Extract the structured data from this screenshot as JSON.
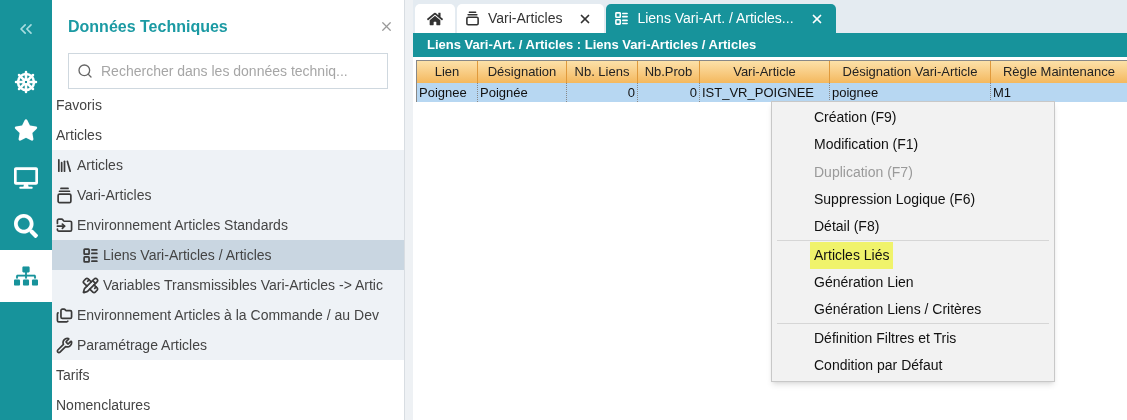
{
  "rail": {
    "items": [
      {
        "kind": "wheel",
        "selected": false
      },
      {
        "kind": "star",
        "selected": false
      },
      {
        "kind": "monitor",
        "selected": false
      },
      {
        "kind": "search",
        "selected": false
      },
      {
        "kind": "sitemap",
        "selected": true
      }
    ]
  },
  "panel": {
    "title": "Données Techniques",
    "search": {
      "placeholder": "Rechercher dans les données techniq..."
    },
    "tree": [
      {
        "label": "Favoris",
        "selected": false
      },
      {
        "label": "Articles",
        "selected": false,
        "children": [
          {
            "label": "Articles",
            "kind": "books",
            "selected": false
          },
          {
            "label": "Vari-Articles",
            "kind": "cards",
            "selected": false
          },
          {
            "label": "Environnement Articles Standards",
            "kind": "folder",
            "selected": false,
            "children": [
              {
                "label": "Liens Vari-Articles / Articles",
                "kind": "grid",
                "selected": true
              },
              {
                "label": "Variables Transmissibles Vari-Articles -> Artic",
                "kind": "tools",
                "selected": false
              }
            ]
          },
          {
            "label": "Environnement Articles à la Commande / au Dev",
            "kind": "folders",
            "selected": false
          },
          {
            "label": "Paramétrage Articles",
            "kind": "wrench",
            "selected": false
          }
        ]
      },
      {
        "label": "Tarifs",
        "selected": false
      },
      {
        "label": "Nomenclatures",
        "selected": false
      }
    ]
  },
  "tabs": [
    {
      "kind": "home",
      "selected": false
    },
    {
      "kind": "page",
      "label": "Vari-Articles",
      "selected": false
    },
    {
      "kind": "page",
      "label": "Liens Vari-Art. / Articles...",
      "selected": true
    }
  ],
  "breadcrumb": "Liens Vari-Art. / Articles : Liens Vari-Articles / Articles",
  "table": {
    "columns": [
      "Lien",
      "Désignation",
      "Nb. Liens",
      "Nb.Prob",
      "Vari-Article",
      "Désignation Vari-Article",
      "Règle Maintenance"
    ],
    "rows": [
      {
        "selected": true,
        "cells": [
          "Poignee",
          "Poignée",
          "0",
          "0",
          "IST_VR_POIGNEE",
          "poignee",
          "M1"
        ]
      }
    ]
  },
  "context_menu": {
    "groups": [
      [
        {
          "label": "Création (F9)",
          "disabled": false,
          "highlighted": false
        },
        {
          "label": "Modification (F1)",
          "disabled": false,
          "highlighted": false
        },
        {
          "label": "Duplication (F7)",
          "disabled": true,
          "highlighted": false
        },
        {
          "label": "Suppression Logique (F6)",
          "disabled": false,
          "highlighted": false
        },
        {
          "label": "Détail (F8)",
          "disabled": false,
          "highlighted": false
        }
      ],
      [
        {
          "label": "Articles Liés",
          "disabled": false,
          "highlighted": true
        },
        {
          "label": "Génération Lien",
          "disabled": false,
          "highlighted": false
        },
        {
          "label": "Génération Liens / Critères",
          "disabled": false,
          "highlighted": false
        }
      ],
      [
        {
          "label": "Définition Filtres et Tris",
          "disabled": false,
          "highlighted": false
        },
        {
          "label": "Condition par Défaut",
          "disabled": false,
          "highlighted": false
        }
      ]
    ]
  }
}
